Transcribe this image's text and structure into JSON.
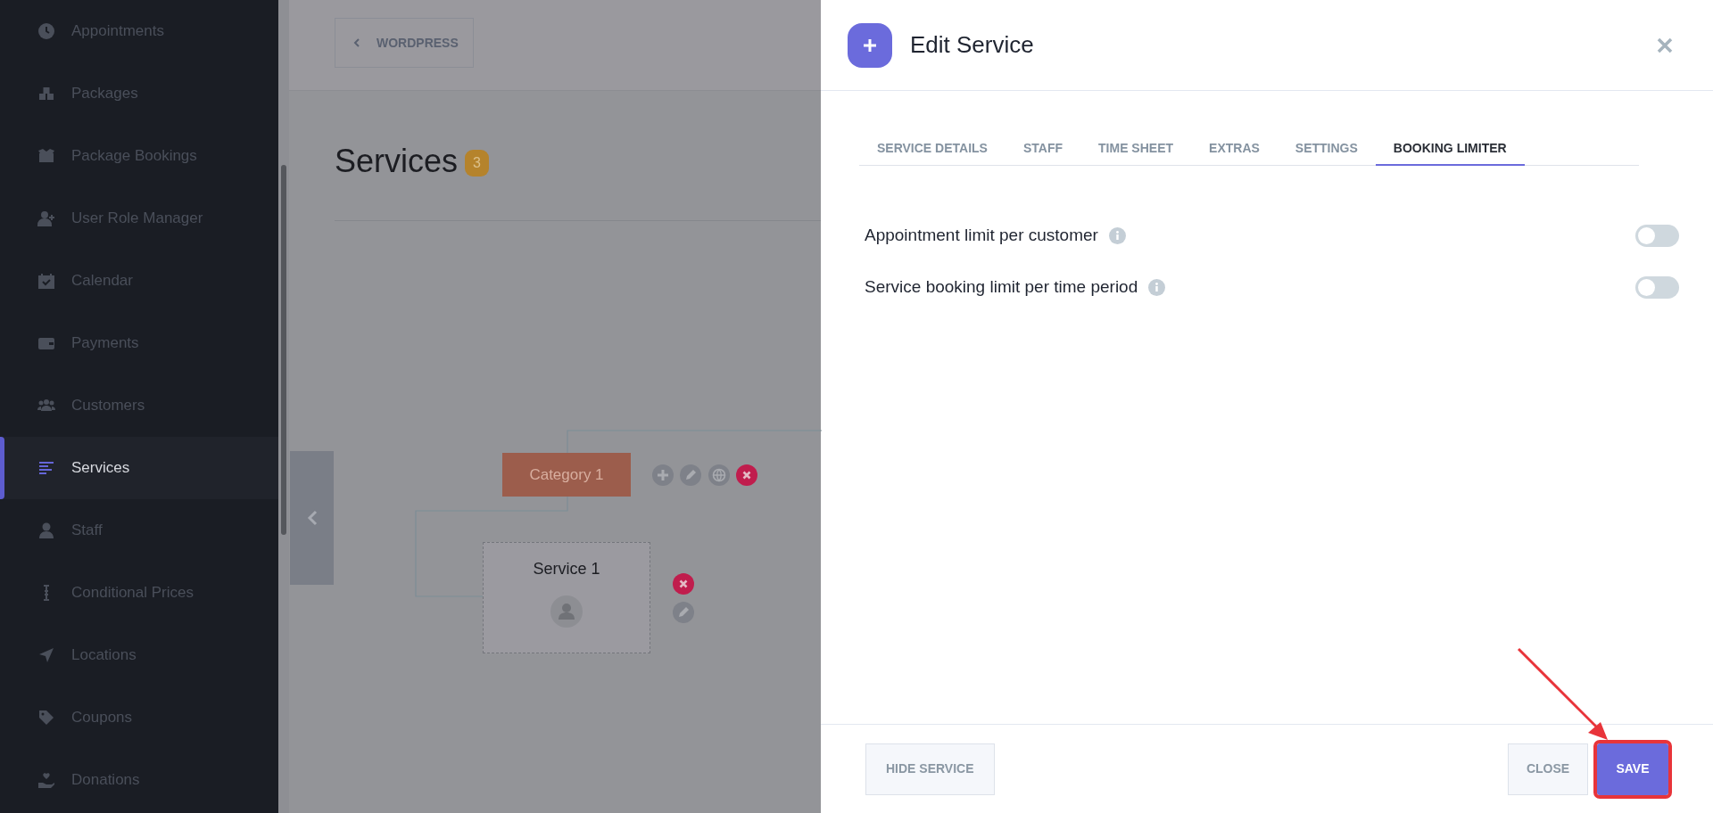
{
  "sidebar": {
    "items": [
      {
        "label": "Appointments",
        "selected": false
      },
      {
        "label": "Packages",
        "selected": false
      },
      {
        "label": "Package Bookings",
        "selected": false
      },
      {
        "label": "User Role Manager",
        "selected": false
      },
      {
        "label": "Calendar",
        "selected": false
      },
      {
        "label": "Payments",
        "selected": false
      },
      {
        "label": "Customers",
        "selected": false
      },
      {
        "label": "Services",
        "selected": true
      },
      {
        "label": "Staff",
        "selected": false
      },
      {
        "label": "Conditional Prices",
        "selected": false
      },
      {
        "label": "Locations",
        "selected": false
      },
      {
        "label": "Coupons",
        "selected": false
      },
      {
        "label": "Donations",
        "selected": false
      }
    ]
  },
  "main": {
    "back_button": "WORDPRESS",
    "title": "Services",
    "count": "3",
    "tree": {
      "category": "Category 1",
      "service": "Service 1"
    }
  },
  "modal": {
    "title": "Edit Service",
    "tabs": [
      {
        "label": "SERVICE DETAILS",
        "selected": false
      },
      {
        "label": "STAFF",
        "selected": false
      },
      {
        "label": "TIME SHEET",
        "selected": false
      },
      {
        "label": "EXTRAS",
        "selected": false
      },
      {
        "label": "SETTINGS",
        "selected": false
      },
      {
        "label": "BOOKING LIMITER",
        "selected": true
      }
    ],
    "settings": [
      {
        "label": "Appointment limit per customer",
        "on": false
      },
      {
        "label": "Service booking limit per time period",
        "on": false
      }
    ],
    "footer": {
      "hide_button": "HIDE SERVICE",
      "close_button": "CLOSE",
      "save_button": "SAVE",
      "save_highlighted": true
    }
  }
}
